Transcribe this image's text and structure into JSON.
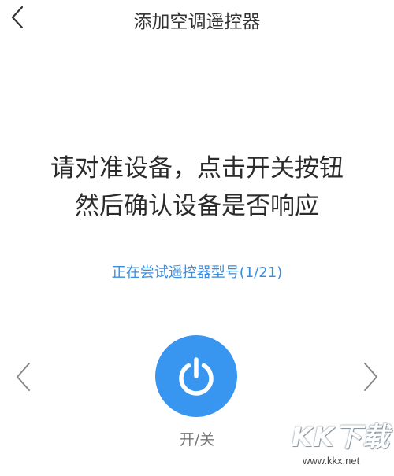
{
  "header": {
    "title": "添加空调遥控器",
    "back_icon": "chevron-left-icon"
  },
  "instruction": {
    "line1": "请对准设备，点击开关按钮",
    "line2": "然后确认设备是否响应"
  },
  "status": {
    "text": "正在尝试遥控器型号(1/21)",
    "color": "#3a8ee0"
  },
  "navigation": {
    "prev_icon": "chevron-left-icon",
    "next_icon": "chevron-right-icon"
  },
  "power": {
    "icon": "power-icon",
    "label": "开/关",
    "color": "#3895f0"
  },
  "watermark": {
    "logo_text": "KK下载",
    "url": "www.kkx.net"
  }
}
